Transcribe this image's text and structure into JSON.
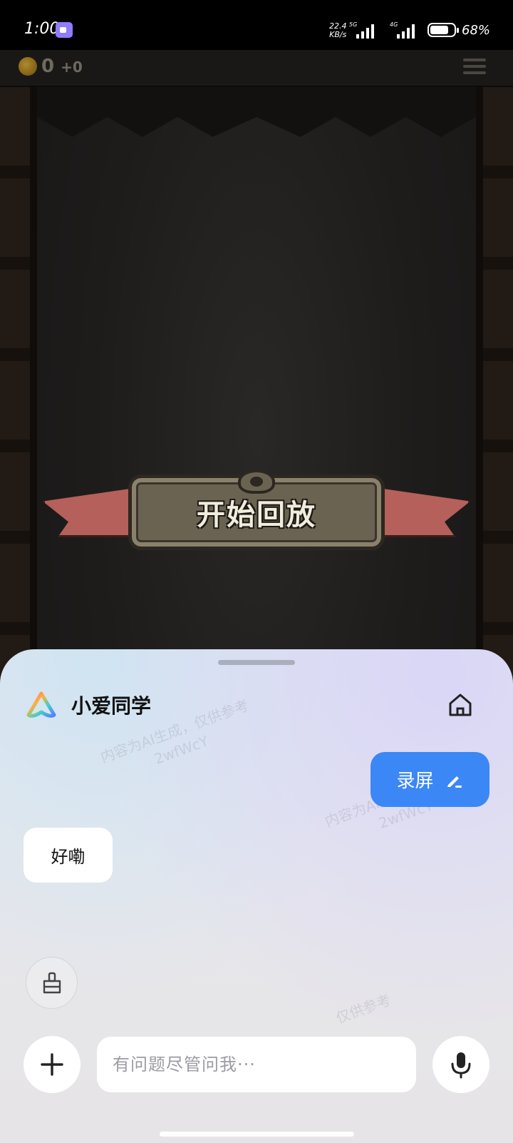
{
  "status_bar": {
    "time": "1:00",
    "net_speed_value": "22.4",
    "net_speed_unit": "KB/s",
    "sim1_tag": "5G",
    "sim2_tag": "4G",
    "battery": "68%",
    "battery_level": 0.68
  },
  "game": {
    "coins": "0",
    "coin_delta": "+0",
    "replay_button_label": "开始回放"
  },
  "assistant": {
    "name": "小爱同学",
    "watermark_line1": "内容为AI生成，仅供参考",
    "watermark_line2": "2wfWcY",
    "watermark_partial": "仅供参考",
    "user_message": "录屏",
    "bot_reply": "好嘞",
    "input_placeholder": "有问题尽管问我···"
  },
  "colors": {
    "accent_blue": "#3b87f6",
    "panel_bg": "#e6e6ec"
  },
  "icons": {
    "home": "home-icon",
    "edit": "pencil-icon",
    "clear": "brush-icon",
    "add": "plus-icon",
    "mic": "microphone-icon"
  }
}
